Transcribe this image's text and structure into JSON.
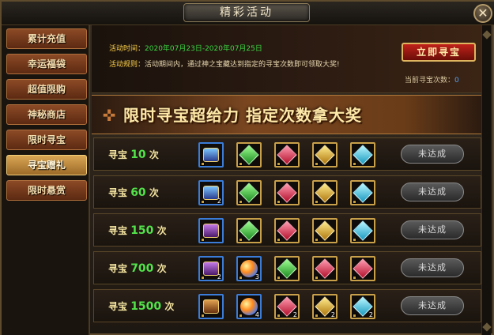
{
  "window": {
    "title": "精彩活动",
    "close_label": "✕"
  },
  "sidebar": {
    "items": [
      {
        "label": "累计充值",
        "active": false
      },
      {
        "label": "幸运福袋",
        "active": false
      },
      {
        "label": "超值限购",
        "active": false
      },
      {
        "label": "神秘商店",
        "active": false
      },
      {
        "label": "限时寻宝",
        "active": false
      },
      {
        "label": "寻宝赠礼",
        "active": true
      },
      {
        "label": "限时悬赏",
        "active": false
      }
    ]
  },
  "info": {
    "time_label": "活动时间：",
    "time_value": "2020年07月23日-2020年07月25日",
    "rule_label": "活动规则：",
    "rule_value": "活动期间内，通过神之宝藏达到指定的寻宝次数即可领取大奖!",
    "button_label": "立即寻宝",
    "count_label": "当前寻宝次数：",
    "count_value": "0"
  },
  "banner": {
    "text": "限时寻宝超给力  指定次数拿大奖"
  },
  "rewards": [
    {
      "prefix": "寻宝",
      "count": "10",
      "suffix": "次",
      "status": "未达成",
      "items": [
        {
          "kind": "chest-blue",
          "qty": ""
        },
        {
          "kind": "gem-green",
          "qty": ""
        },
        {
          "kind": "gem-red",
          "qty": ""
        },
        {
          "kind": "gem-gold",
          "qty": ""
        },
        {
          "kind": "gem-cyan",
          "qty": ""
        }
      ]
    },
    {
      "prefix": "寻宝",
      "count": "60",
      "suffix": "次",
      "status": "未达成",
      "items": [
        {
          "kind": "chest-blue",
          "qty": "2"
        },
        {
          "kind": "gem-green",
          "qty": ""
        },
        {
          "kind": "gem-red",
          "qty": ""
        },
        {
          "kind": "gem-gold",
          "qty": ""
        },
        {
          "kind": "gem-cyan",
          "qty": ""
        }
      ]
    },
    {
      "prefix": "寻宝",
      "count": "150",
      "suffix": "次",
      "status": "未达成",
      "items": [
        {
          "kind": "chest-purple",
          "qty": ""
        },
        {
          "kind": "gem-green",
          "qty": ""
        },
        {
          "kind": "gem-red",
          "qty": ""
        },
        {
          "kind": "gem-gold",
          "qty": ""
        },
        {
          "kind": "gem-cyan",
          "qty": ""
        }
      ]
    },
    {
      "prefix": "寻宝",
      "count": "700",
      "suffix": "次",
      "status": "未达成",
      "items": [
        {
          "kind": "chest-purple",
          "qty": "2"
        },
        {
          "kind": "orb",
          "qty": "3"
        },
        {
          "kind": "gem-green",
          "qty": ""
        },
        {
          "kind": "gem-red",
          "qty": ""
        },
        {
          "kind": "gem-red",
          "qty": ""
        }
      ]
    },
    {
      "prefix": "寻宝",
      "count": "1500",
      "suffix": "次",
      "status": "未达成",
      "items": [
        {
          "kind": "chest-wood",
          "qty": ""
        },
        {
          "kind": "orb",
          "qty": "4"
        },
        {
          "kind": "gem-red",
          "qty": "2"
        },
        {
          "kind": "gem-gold",
          "qty": "2"
        },
        {
          "kind": "gem-cyan",
          "qty": "2"
        }
      ]
    }
  ]
}
